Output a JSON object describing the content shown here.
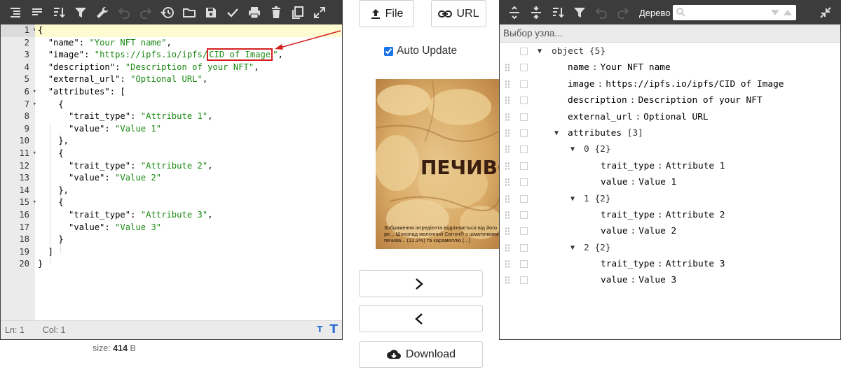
{
  "editor": {
    "line_numbers": [
      "1",
      "2",
      "3",
      "4",
      "5",
      "6",
      "7",
      "8",
      "9",
      "10",
      "11",
      "12",
      "13",
      "14",
      "15",
      "16",
      "17",
      "18",
      "19",
      "20"
    ],
    "status": {
      "line": "Ln: 1",
      "col": "Col: 1"
    },
    "size_label": "size:",
    "size_value": "414",
    "size_unit": "B",
    "code": {
      "l1": "{",
      "k_name": "\"name\"",
      "v_name": "\"Your NFT name\"",
      "k_image": "\"image\"",
      "v_image_pre": "\"https://ipfs.io/ipfs/",
      "v_image_cid": "CID of Image",
      "v_image_post": "\"",
      "k_description": "\"description\"",
      "v_description": "\"Description of your NFT\"",
      "k_external": "\"external_url\"",
      "v_external": "\"Optional URL\"",
      "k_attributes": "\"attributes\"",
      "k_trait": "\"trait_type\"",
      "k_value": "\"value\"",
      "v_attr1": "\"Attribute 1\"",
      "v_val1": "\"Value 1\"",
      "v_attr2": "\"Attribute 2\"",
      "v_val2": "\"Value 2\"",
      "v_attr3": "\"Attribute 3\"",
      "v_val3": "\"Value 3\""
    }
  },
  "middle": {
    "file_label": "File",
    "url_label": "URL",
    "auto_update_label": "Auto Update",
    "preview_text": "ПЕЧИВО",
    "preview_caption": "Зображення інгредієнта відрізняється від його ре... Шоколад молочний Світоч® з шматочками печива... (12.3%) та карамеллю (...)",
    "download_label": "Download"
  },
  "tree": {
    "mode_label": "Дерево",
    "node_path_placeholder": "Выбор узла...",
    "root_label": "object",
    "root_count": "{5}",
    "name_key": "name",
    "name_val": "Your NFT name",
    "image_key": "image",
    "image_val": "https://ipfs.io/ipfs/CID of Image",
    "description_key": "description",
    "description_val": "Description of your NFT",
    "external_key": "external_url",
    "external_val": "Optional URL",
    "attributes_key": "attributes",
    "attributes_count": "[3]",
    "item0_index": "0",
    "item1_index": "1",
    "item2_index": "2",
    "item_count": "{2}",
    "trait_key": "trait_type",
    "value_key": "value",
    "attr1": "Attribute 1",
    "val1": "Value 1",
    "attr2": "Attribute 2",
    "val2": "Value 2",
    "attr3": "Attribute 3",
    "val3": "Value 3",
    "colon": ":"
  },
  "colors": {
    "toolbar": "#3c3c3c",
    "string": "#1a8a12",
    "highlight_box": "#d62020",
    "active_line": "#fffbd1"
  }
}
